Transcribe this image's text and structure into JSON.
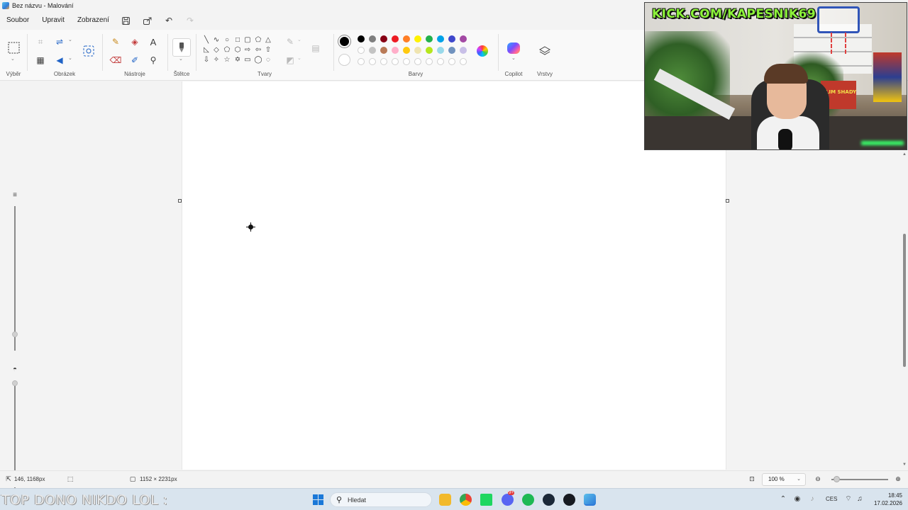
{
  "window": {
    "title": "Bez názvu - Malování"
  },
  "menu": {
    "file": "Soubor",
    "edit": "Upravit",
    "view": "Zobrazení"
  },
  "ribbon": {
    "groups": {
      "select": "Výběr",
      "image": "Obrázek",
      "tools": "Nástroje",
      "brushes": "Štětce",
      "shapes": "Tvary",
      "colors": "Barvy",
      "copilot": "Copilot",
      "layers": "Vrstvy"
    },
    "text_tool_glyph": "A",
    "active_color": "#000000",
    "secondary_color": "#ffffff",
    "palette_row1": [
      "#000000",
      "#7f7f7f",
      "#880015",
      "#ed1c24",
      "#ff7f27",
      "#fff200",
      "#22b14c",
      "#00a2e8",
      "#3f48cc",
      "#a349a4"
    ],
    "palette_row2": [
      "#ffffff",
      "#c3c3c3",
      "#b97a57",
      "#ffaec9",
      "#ffc90e",
      "#efe4b0",
      "#b5e61d",
      "#99d9ea",
      "#7092be",
      "#c8bfe7"
    ]
  },
  "stream": {
    "banner": "KICK.COM/KAPESNIK69",
    "jersey_text": "SLIM SHADY",
    "ticker": "TOP DONO NIKDO LOL :"
  },
  "status": {
    "cursor_pos": "146, 1168px",
    "canvas_size": "1152 × 2231px",
    "zoom": "100 %"
  },
  "taskbar": {
    "search_placeholder": "Hledat",
    "language": "CES",
    "time": "18:45",
    "date": "17.02.2026",
    "discord_badge": "9+"
  }
}
